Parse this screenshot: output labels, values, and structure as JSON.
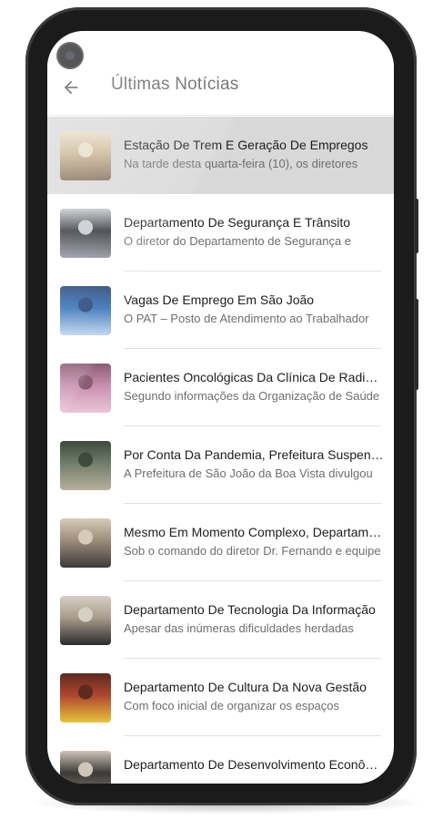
{
  "appbar": {
    "title": "Últimas Notícias",
    "back_icon": "arrow-left-icon"
  },
  "news": [
    {
      "title": "Estação De Trem E Geração De Empregos",
      "summary": "Na tarde desta quarta-feira (10), os diretores",
      "thumb_colors": [
        "#c9b38f",
        "#7d6a55",
        "#e8dcc7"
      ],
      "selected": true
    },
    {
      "title": "Departamento De Segurança E Trânsito",
      "summary": "O diretor do Departamento de Segurança e",
      "thumb_colors": [
        "#2b2d33",
        "#8a8f98",
        "#c4c7cc"
      ],
      "selected": false
    },
    {
      "title": "Vagas De Emprego Em São João",
      "summary": "O PAT – Posto de Atendimento ao Trabalhador",
      "thumb_colors": [
        "#2f6db5",
        "#bcd3ee",
        "#1d3f73"
      ],
      "selected": false
    },
    {
      "title": "Pacientes Oncológicas Da Clínica De Radioterapia",
      "summary": "Segundo informações da Organização de Saúde",
      "thumb_colors": [
        "#c98fb0",
        "#e9c7d6",
        "#8a5c72"
      ],
      "selected": false
    },
    {
      "title": "Por Conta Da Pandemia, Prefeitura Suspende",
      "summary": "A Prefeitura de São João da Boa Vista divulgou",
      "thumb_colors": [
        "#6f7d6a",
        "#b7b09a",
        "#3e4a3c"
      ],
      "selected": false
    },
    {
      "title": "Mesmo Em Momento Complexo, Departamento",
      "summary": "Sob o comando do diretor Dr. Fernando e equipe",
      "thumb_colors": [
        "#9c8c7a",
        "#3d3a3a",
        "#d9cbb9"
      ],
      "selected": false
    },
    {
      "title": "Departamento De Tecnologia Da Informação",
      "summary": "Apesar das inúmeras dificuldades herdadas",
      "thumb_colors": [
        "#a89b8a",
        "#2c2c2c",
        "#d7d0c4"
      ],
      "selected": false
    },
    {
      "title": "Departamento De Cultura Da Nova Gestão",
      "summary": "Com foco inicial de organizar os espaços",
      "thumb_colors": [
        "#b0452f",
        "#e6c43c",
        "#5e2a1f"
      ],
      "selected": false
    },
    {
      "title": "Departamento De Desenvolvimento Econômico",
      "summary": "",
      "thumb_colors": [
        "#3c3a38",
        "#8b8177",
        "#cfc5b8"
      ],
      "selected": false
    }
  ]
}
